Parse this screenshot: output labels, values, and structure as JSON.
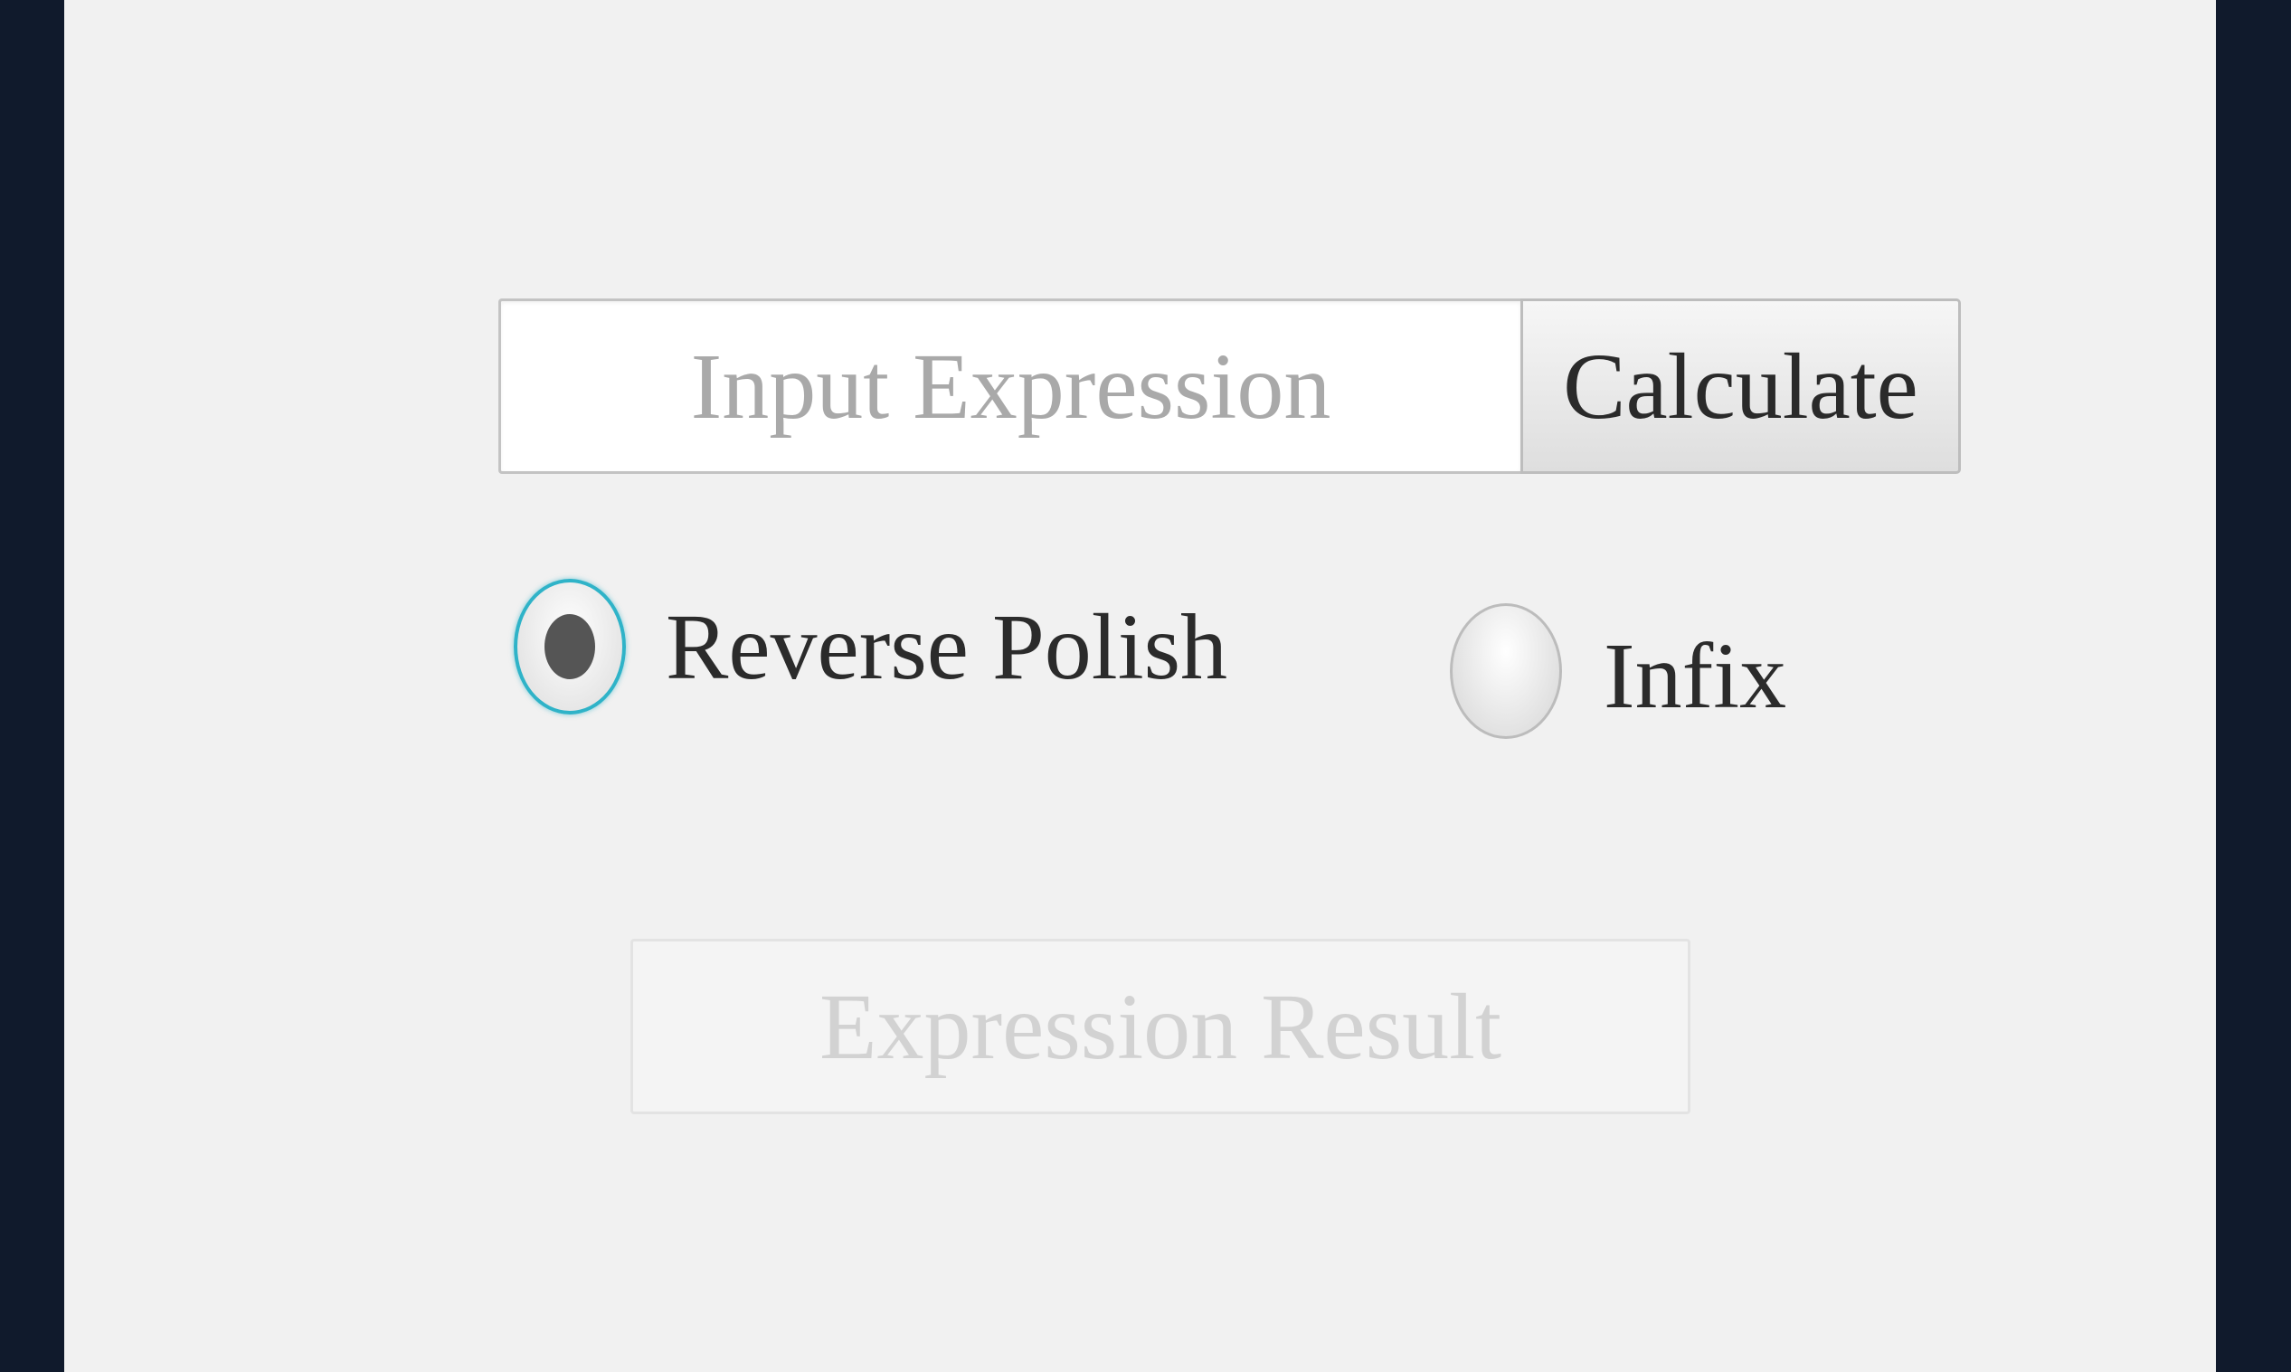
{
  "expression_input": {
    "placeholder": "Input Expression",
    "value": ""
  },
  "calculate_button": {
    "label": "Calculate"
  },
  "notation": {
    "options": [
      {
        "label": "Reverse Polish",
        "checked": true
      },
      {
        "label": "Infix",
        "checked": false
      }
    ],
    "accent_color": "#2fb3c8"
  },
  "result_field": {
    "placeholder": "Expression Result"
  }
}
